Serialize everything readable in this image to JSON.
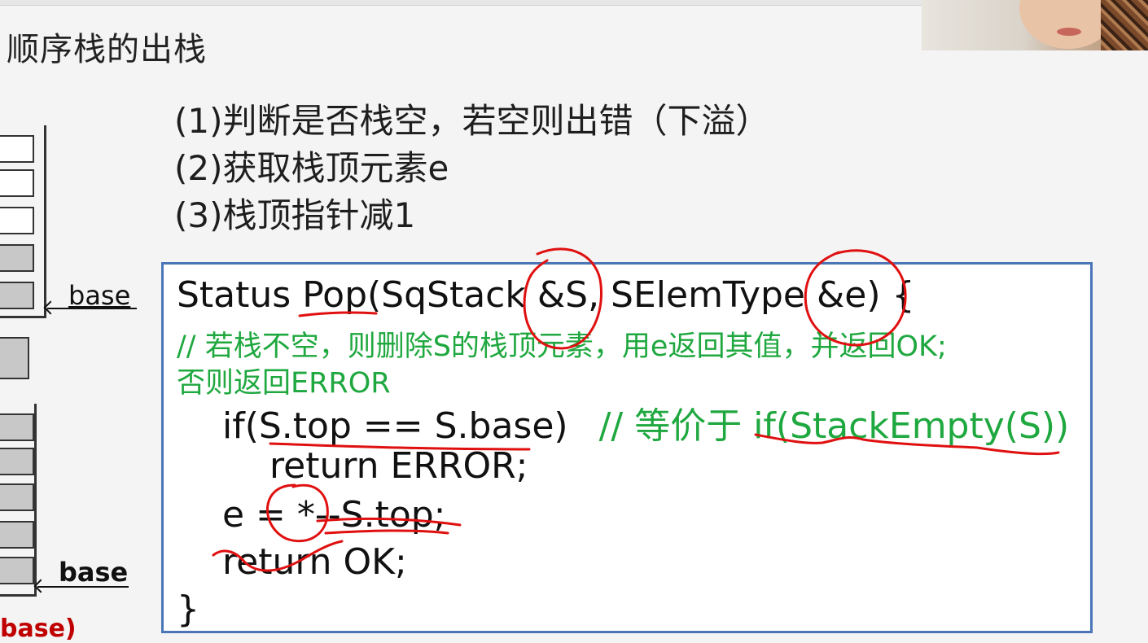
{
  "slide": {
    "title": "顺序栈的出栈"
  },
  "steps": [
    "(1)判断是否栈空，若空则出错（下溢）",
    "(2)获取栈顶元素e",
    "(3)栈顶指针减1"
  ],
  "diagram": {
    "base_label_top": "base",
    "base_label_bottom": "base",
    "partial_label": "base)"
  },
  "code": {
    "signature": "Status Pop(SqStack &S, SElemType &e) {",
    "comment_line1": "// 若栈不空，则删除S的栈顶元素，用e返回其值，并返回OK;",
    "comment_line2": "否则返回ERROR",
    "if_statement": "if(S.top == S.base)",
    "if_comment": "// 等价于 if(StackEmpty(S))",
    "return_error": "return ERROR;",
    "assign": "e = *--S.top;",
    "return_ok": "return OK;",
    "closing_brace": "}"
  },
  "colors": {
    "comment": "#1fa83f",
    "code_border": "#4a76b8",
    "annotation_ink": "#e01010",
    "partial_label": "#c00000"
  }
}
